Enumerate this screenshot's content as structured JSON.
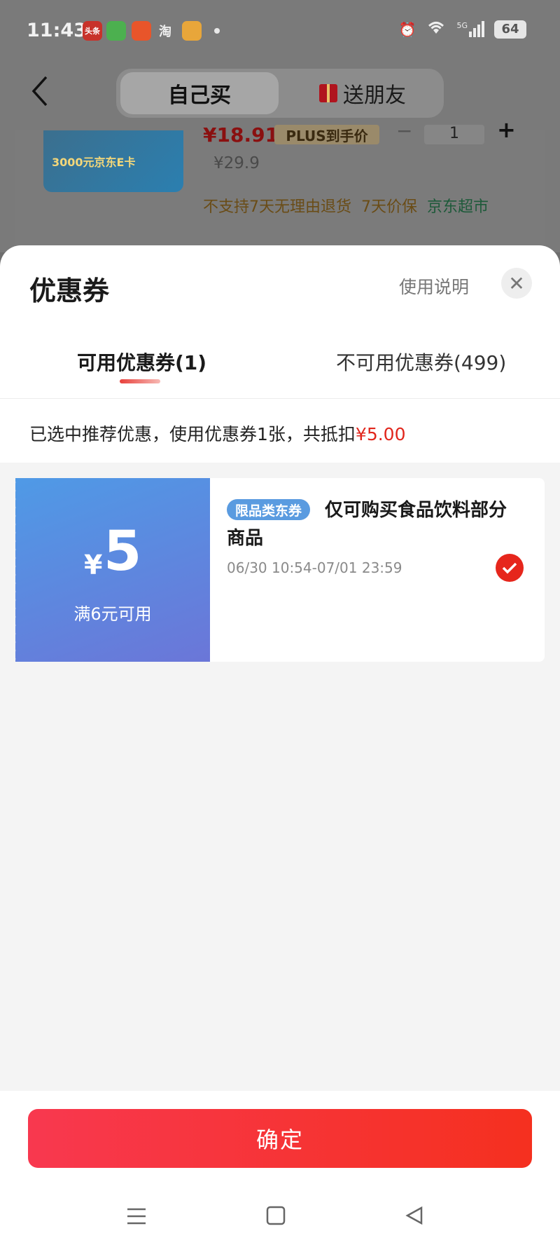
{
  "status_bar": {
    "time": "11:43",
    "apps": [
      "头条",
      "",
      "",
      "淘",
      ""
    ],
    "network": "5G",
    "battery": "64"
  },
  "nav": {
    "back_icon": "chevron-left-icon",
    "tab_self": "自己买",
    "tab_friend": "送朋友"
  },
  "product": {
    "image_text": "3000元京东E卡",
    "price": "¥18.91",
    "plus_tag": "PLUS到手价",
    "quantity": "1",
    "original_price": "¥29.9",
    "tag_no_return": "不支持7天无理由退货",
    "tag_price_protect": "7天价保",
    "tag_store": "京东超市"
  },
  "sheet": {
    "title": "优惠券",
    "help": "使用说明",
    "close_icon": "close-icon",
    "tabs": {
      "available": "可用优惠券(1)",
      "unavailable": "不可用优惠券(499)"
    },
    "summary_text": "已选中推荐优惠，使用优惠券1张，共抵扣",
    "summary_amount": "¥5.00"
  },
  "coupons": [
    {
      "currency": "¥",
      "amount": "5",
      "condition": "满6元可用",
      "badge": "限品类东券",
      "description": "仅可购买食品饮料部分商品",
      "validity": "06/30 10:54-07/01 23:59",
      "selected": true
    }
  ],
  "footer": {
    "confirm": "确定"
  },
  "colors": {
    "accent_red": "#E6261C",
    "coupon_blue": "#5A9BE0"
  }
}
